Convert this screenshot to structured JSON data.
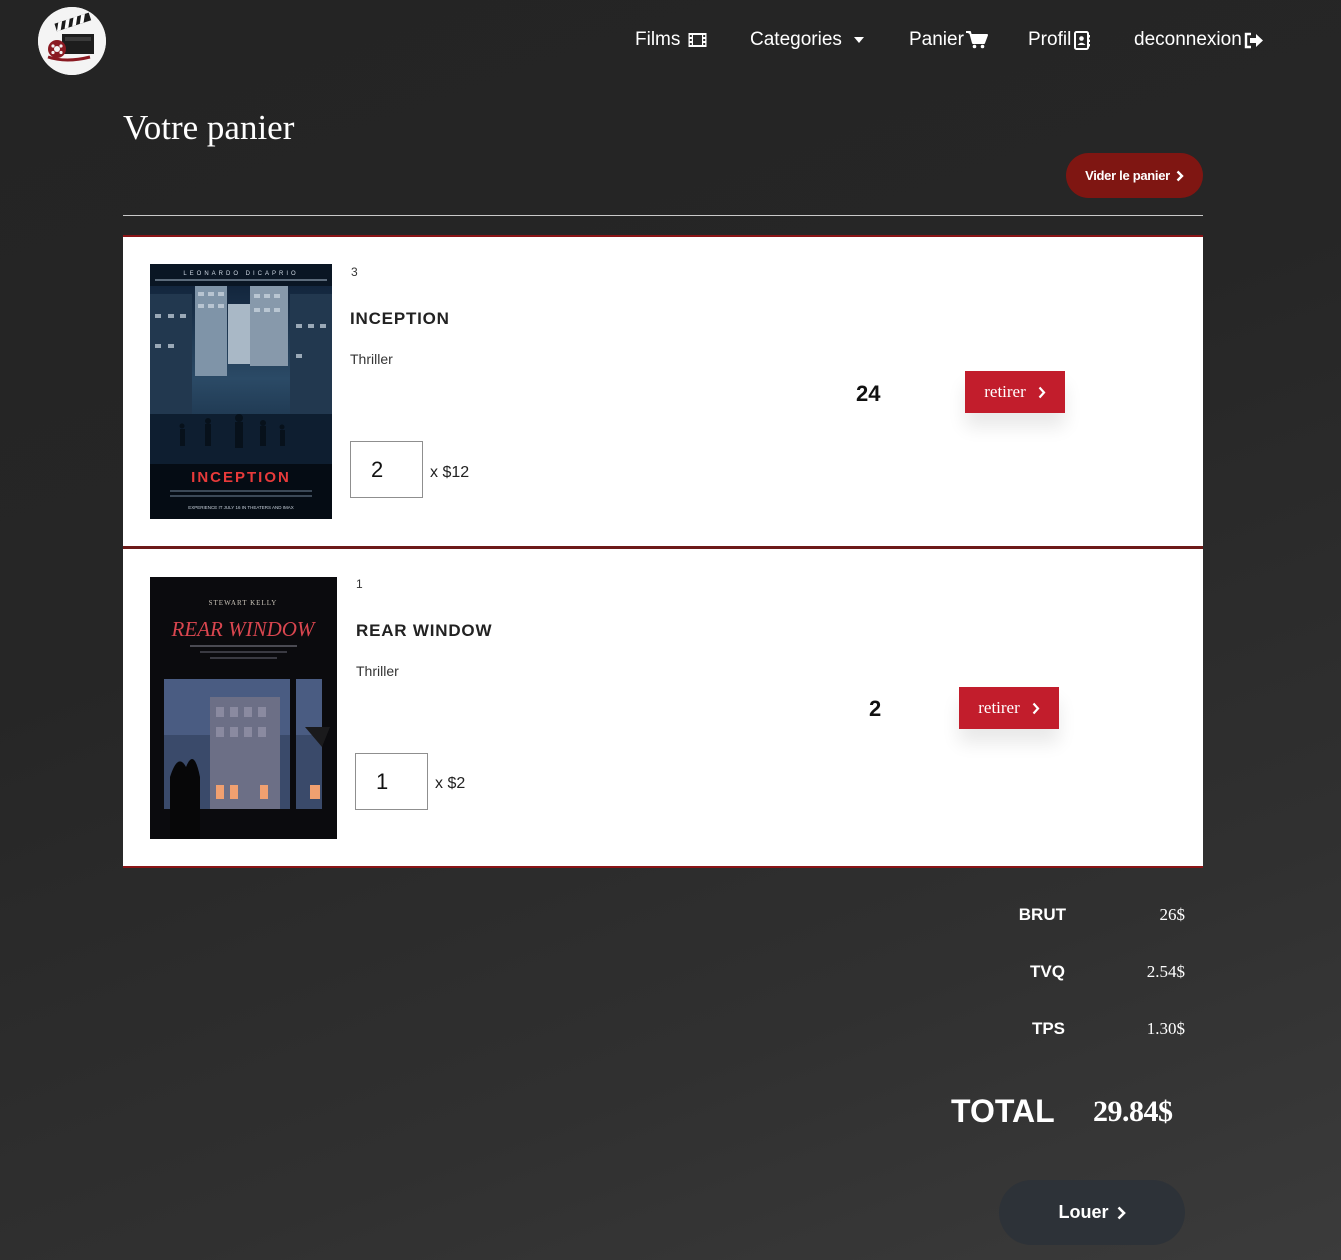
{
  "nav": {
    "films": "Films",
    "categories": "Categories",
    "panier": "Panier",
    "profil": "Profil",
    "logout": "deconnexion"
  },
  "page": {
    "title": "Votre panier",
    "clear_button": "Vider le panier"
  },
  "cart_items": [
    {
      "id": "3",
      "title": "INCEPTION",
      "genre": "Thriller",
      "quantity": "2",
      "unit_price": "x $12",
      "line_total": "24",
      "remove_label": "retirer",
      "poster": {
        "top_text": "LEONARDO DICAPRIO",
        "title_text": "INCEPTION",
        "footer_text": "EXPERIENCE IT JULY 16 IN THEATERS AND IMAX",
        "accent_color": "#e83a3a"
      }
    },
    {
      "id": "1",
      "title": "REAR WINDOW",
      "genre": "Thriller",
      "quantity": "1",
      "unit_price": "x $2",
      "line_total": "2",
      "remove_label": "retirer",
      "poster": {
        "top_text": "STEWART   KELLY",
        "title_text": "REAR WINDOW",
        "accent_color": "#d9464f"
      }
    }
  ],
  "summary": {
    "brut_label": "BRUT",
    "brut_value": "26$",
    "tvq_label": "TVQ",
    "tvq_value": "2.54$",
    "tps_label": "TPS",
    "tps_value": "1.30$",
    "total_label": "TOTAL",
    "total_value": "29.84$"
  },
  "actions": {
    "rent_button": "Louer"
  },
  "colors": {
    "clear_button": "#7f1612",
    "remove_button": "#c21d2c",
    "rent_button": "#2d3238",
    "card_border": "#8a1416"
  }
}
